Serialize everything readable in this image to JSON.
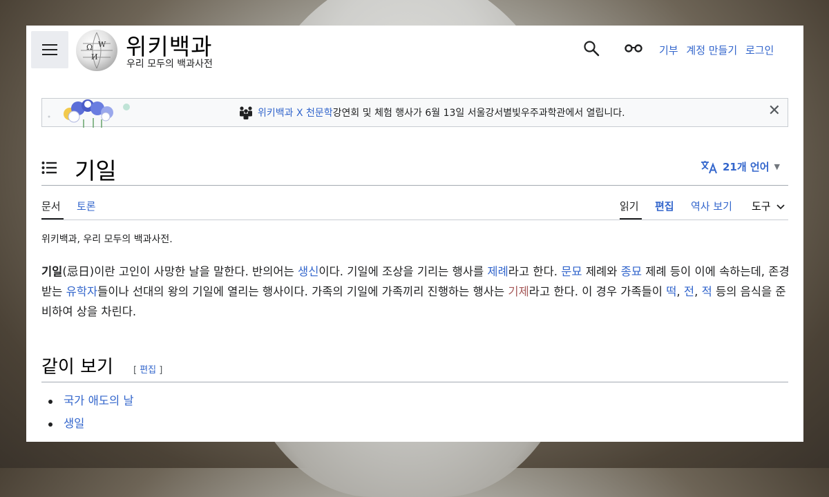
{
  "header": {
    "wordmark": "위키백과",
    "tagline": "우리 모두의 백과사전",
    "links": [
      "기부",
      "계정 만들기",
      "로그인"
    ]
  },
  "banner": {
    "link1": "위키백과 X 천문학",
    "text": " 강연회 및 체험 행사가 6월 13일 서울강서별빛우주과학관에서 열립니다.",
    "close": "✕"
  },
  "article": {
    "title": "기일",
    "languages": "21개 언어",
    "tabs_left": [
      "문서",
      "토론"
    ],
    "tabs_right": [
      "읽기",
      "편집",
      "역사 보기",
      "도구"
    ],
    "sitesub": "위키백과, 우리 모두의 백과사전.",
    "p": {
      "t1": "기일",
      "t2": "(忌日)이란 고인이 사망한 날을 말한다. 반의어는 ",
      "l1": "생신",
      "t3": "이다. 기일에 조상을 기리는 행사를 ",
      "l2": "제례",
      "t4": "라고 한다. ",
      "l3": "문묘",
      "t5": " 제례와 ",
      "l4": "종묘",
      "t6": " 제례 등이 이에 속하는데, 존경받는 ",
      "l5": "유학자",
      "t7": "들이나 선대의 왕의 기일에 열리는 행사이다. 가족의 기일에 가족끼리 진행하는 행사는 ",
      "l6": "기제",
      "t8": "라고 한다. 이 경우 가족들이 ",
      "l7": "떡",
      "t9": ", ",
      "l8": "전",
      "t10": ", ",
      "l9": "적",
      "t11": " 등의 음식을 준비하여 상을 차린다."
    },
    "section": {
      "heading": "같이 보기",
      "edit_open": "[ ",
      "edit": "편집",
      "edit_close": " ]",
      "items": [
        "국가 애도의 날",
        "생일"
      ]
    }
  },
  "colors": {
    "link": "#3366cc",
    "red_link": "#a55858",
    "text": "#202122"
  }
}
